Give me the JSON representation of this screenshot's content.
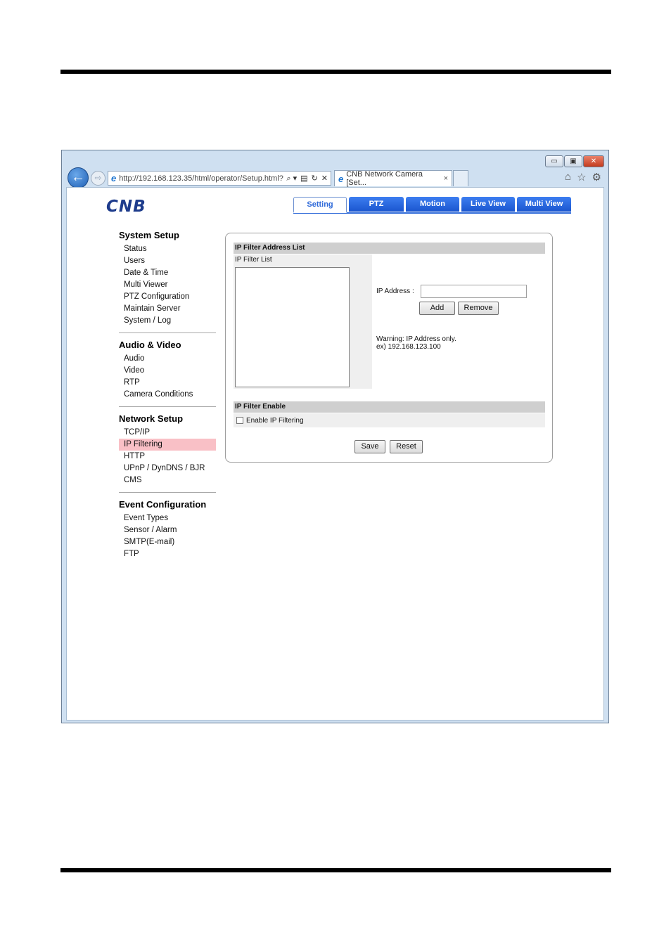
{
  "browser": {
    "address": "http://192.168.123.35/html/operator/Setup.html?",
    "tab_title": "CNB Network Camera [Set...",
    "tab_close": "×",
    "win_min": "▭",
    "win_max": "▣",
    "win_close": "✕",
    "back": "←",
    "forward": "⇨",
    "addr_tools": [
      "⌕ ▾",
      "▤",
      "↻",
      "✕"
    ],
    "tools": [
      "⌂",
      "☆",
      "⚙"
    ]
  },
  "logo": "CNB",
  "nav_tabs": [
    {
      "label": "Setting",
      "active": true
    },
    {
      "label": "PTZ"
    },
    {
      "label": "Motion"
    },
    {
      "label": "Live View"
    },
    {
      "label": "Multi View"
    }
  ],
  "menu": [
    {
      "title": "System Setup",
      "items": [
        "Status",
        "Users",
        "Date & Time",
        "Multi Viewer",
        "PTZ Configuration",
        "Maintain Server",
        "System / Log"
      ]
    },
    {
      "title": "Audio & Video",
      "items": [
        "Audio",
        "Video",
        "RTP",
        "Camera Conditions"
      ]
    },
    {
      "title": "Network Setup",
      "items": [
        "TCP/IP",
        "IP Filtering",
        "HTTP",
        "UPnP / DynDNS / BJR",
        "CMS"
      ]
    },
    {
      "title": "Event Configuration",
      "items": [
        "Event Types",
        "Sensor / Alarm",
        "SMTP(E-mail)",
        "FTP"
      ]
    }
  ],
  "selected_menu_item": "IP Filtering",
  "panel": {
    "address_list_title": "IP Filter Address List",
    "list_label": "IP Filter List",
    "ip_label": "IP Address :",
    "ip_value": "",
    "add_label": "Add",
    "remove_label": "Remove",
    "warning_line1": "Warning: IP Address only.",
    "warning_line2": "ex) 192.168.123.100",
    "enable_title": "IP Filter Enable",
    "enable_label": "Enable IP Filtering",
    "enable_checked": false,
    "save_label": "Save",
    "reset_label": "Reset"
  }
}
